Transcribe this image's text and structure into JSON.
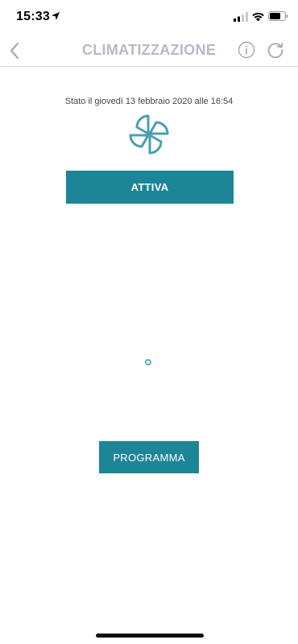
{
  "status_bar": {
    "time": "15:33"
  },
  "nav": {
    "title": "CLIMATIZZAZIONE"
  },
  "main": {
    "status_text": "Stato il giovedì 13 febbraio 2020 alle 16:54",
    "activate_label": "ATTIVA",
    "program_label": "PROGRAMMA"
  },
  "colors": {
    "accent": "#1c8597",
    "title": "#b7b9c9",
    "icon_gray": "#a6a7b1",
    "fan_icon": "#4a9fb1"
  },
  "icons": {
    "back": "chevron-left-icon",
    "info": "info-icon",
    "refresh": "refresh-icon",
    "fan": "fan-icon",
    "location": "location-arrow-icon",
    "signal": "cellular-signal-icon",
    "wifi": "wifi-icon",
    "battery": "battery-icon"
  }
}
